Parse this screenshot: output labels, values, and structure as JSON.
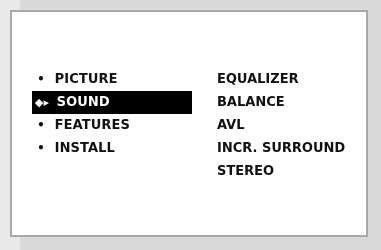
{
  "menu": {
    "items": [
      {
        "label": "PICTURE",
        "selected": false,
        "marker": "bullet-icon"
      },
      {
        "label": "SOUND",
        "selected": true,
        "marker": "up-down-right-arrows-icon"
      },
      {
        "label": "FEATURES",
        "selected": false,
        "marker": "bullet-icon"
      },
      {
        "label": "INSTALL",
        "selected": false,
        "marker": "bullet-icon"
      }
    ]
  },
  "submenu": {
    "items": [
      {
        "label": "EQUALIZER"
      },
      {
        "label": "BALANCE"
      },
      {
        "label": "AVL"
      },
      {
        "label": "INCR. SURROUND"
      },
      {
        "label": "STEREO"
      }
    ]
  },
  "colors": {
    "background": "#dcdcdc",
    "panel": "#ffffff",
    "text": "#111111",
    "selected_bg": "#000000",
    "selected_text": "#ffffff"
  }
}
